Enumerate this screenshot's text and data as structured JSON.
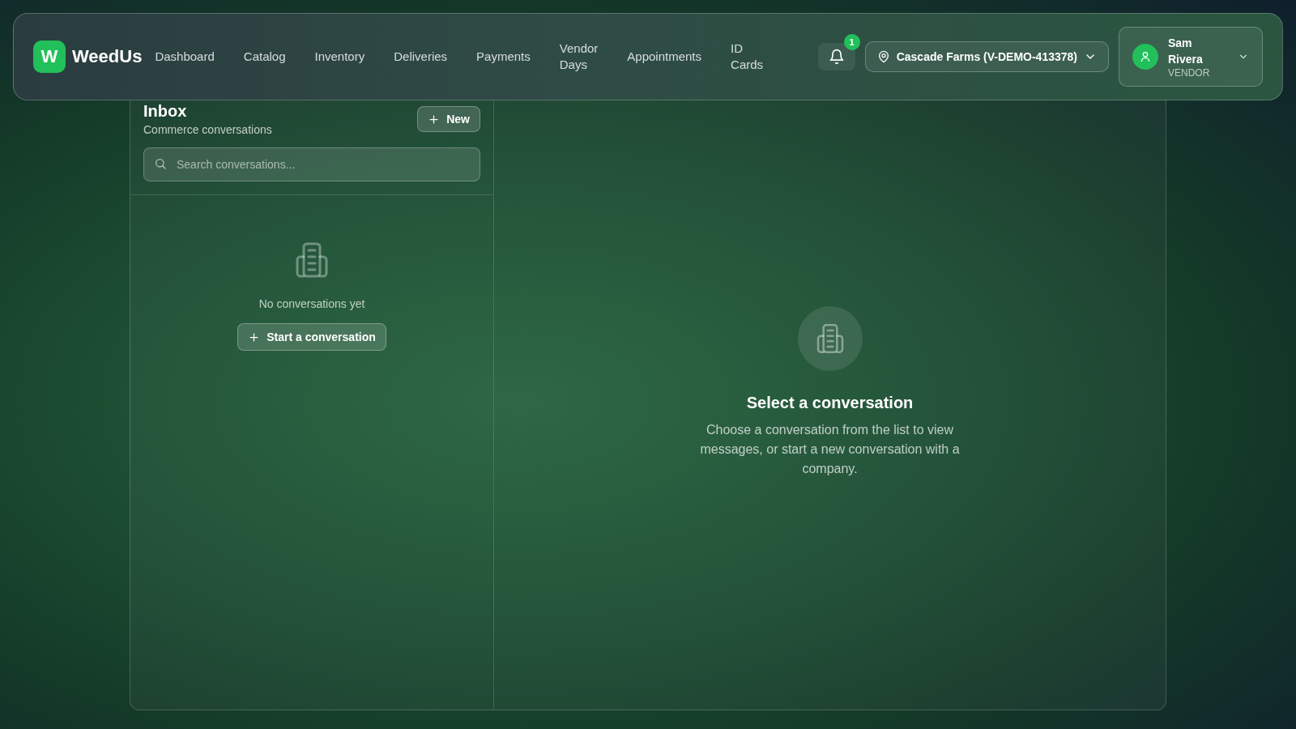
{
  "brand": {
    "logo_letter": "W",
    "name": "WeedUs"
  },
  "nav": [
    {
      "label": "Dashboard"
    },
    {
      "label": "Catalog"
    },
    {
      "label": "Inventory"
    },
    {
      "label": "Deliveries"
    },
    {
      "label": "Payments"
    },
    {
      "label": "Vendor Days"
    },
    {
      "label": "Appointments"
    },
    {
      "label": "ID Cards"
    }
  ],
  "notifications": {
    "count": "1"
  },
  "location": {
    "label": "Cascade Farms (V-DEMO-413378)"
  },
  "user": {
    "name": "Sam Rivera",
    "role": "VENDOR"
  },
  "inbox": {
    "title": "Inbox",
    "subtitle": "Commerce conversations",
    "new_button": "New",
    "search": {
      "placeholder": "Search conversations..."
    },
    "empty_text": "No conversations yet",
    "start_button": "Start a conversation"
  },
  "detail": {
    "title": "Select a conversation",
    "text": "Choose a conversation from the list to view messages, or start a new conversation with a company."
  }
}
